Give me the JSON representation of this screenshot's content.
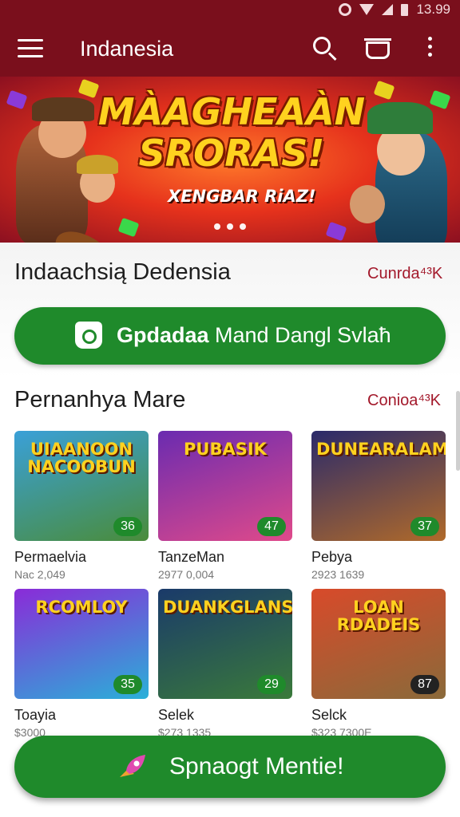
{
  "status_bar": {
    "time": "13.99"
  },
  "app_bar": {
    "title": "Indanesia"
  },
  "banner": {
    "title_line1": "MÀAGHEAÀN",
    "title_line2": "SRORAS!",
    "tagline": "XENGBAR RiAZ!",
    "carousel_pages": 3
  },
  "featured_section": {
    "title": "Indaachsią Dedensia",
    "link": "Cunrda⁴³K",
    "primary_button": {
      "bold": "Gpdadaa",
      "rest": " Mand Dangl Svlaħ"
    }
  },
  "popular_section": {
    "title": "Pernanhya Mare",
    "link": "Conioa⁴³K",
    "games": [
      {
        "thumb_title": "UIAANOON NACOOBUN",
        "name": "Permaelvia",
        "meta": "Nac 2,049",
        "rating": "36",
        "colors": [
          "#3aa0d8",
          "#4a8c3a"
        ]
      },
      {
        "thumb_title": "PUBASIK",
        "name": "TanzeMan",
        "meta": "2977 0,004",
        "rating": "47",
        "colors": [
          "#6a2bb0",
          "#e04a8a"
        ]
      },
      {
        "thumb_title": "DUNEARALAM",
        "name": "Pebya",
        "meta": "2923 1639",
        "rating": "37",
        "colors": [
          "#2a2a6a",
          "#b06a2a"
        ]
      },
      {
        "thumb_title": "RCOMLOY",
        "name": "Toayia",
        "meta": "$3000",
        "rating": "35",
        "colors": [
          "#8a2bd8",
          "#2ab0d8"
        ]
      },
      {
        "thumb_title": "DUANKGLANS",
        "name": "Selek",
        "meta": "$273 1335",
        "rating": "29",
        "colors": [
          "#1a3a6a",
          "#3a7a3a"
        ]
      },
      {
        "thumb_title": "LOAN RDADEIS",
        "name": "Selck",
        "meta": "$323 7300E",
        "rating": "87",
        "colors": [
          "#d84a2a",
          "#8a6a3a"
        ]
      }
    ]
  },
  "cta_button": {
    "label": "Spnaogt Mentie!"
  },
  "icons": {
    "menu": "hamburger-icon",
    "search": "search-icon",
    "cart": "shopping-bag-icon",
    "more": "more-vertical-icon",
    "store": "store-bag-icon",
    "cta": "rocket-icon"
  },
  "colors": {
    "app_bar": "#7a0f1c",
    "primary_green": "#1f8a2b",
    "link_red": "#a3192b"
  }
}
